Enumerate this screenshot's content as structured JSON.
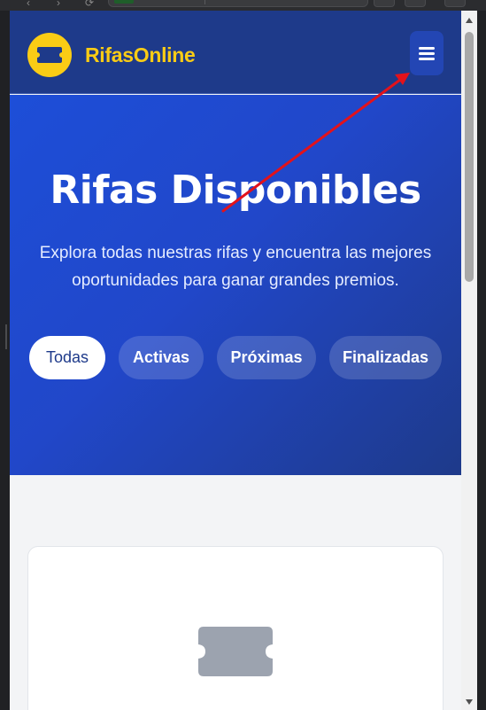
{
  "brand": {
    "name": "RifasOnline",
    "logo_icon": "ticket-icon",
    "accent_color": "#facc15"
  },
  "header": {
    "menu_icon": "hamburger-menu-icon",
    "background_color": "#1e3a8a"
  },
  "hero": {
    "title": "Rifas Disponibles",
    "subtitle": "Explora todas nuestras rifas y encuentra las mejores oportunidades para ganar grandes premios."
  },
  "filters": {
    "items": [
      {
        "label": "Todas",
        "active": true
      },
      {
        "label": "Activas",
        "active": false
      },
      {
        "label": "Próximas",
        "active": false
      },
      {
        "label": "Finalizadas",
        "active": false
      }
    ]
  },
  "empty_state": {
    "icon": "ticket-icon"
  },
  "annotation": {
    "type": "arrow",
    "color": "#e3121b",
    "points_to": "hamburger-menu-button"
  }
}
